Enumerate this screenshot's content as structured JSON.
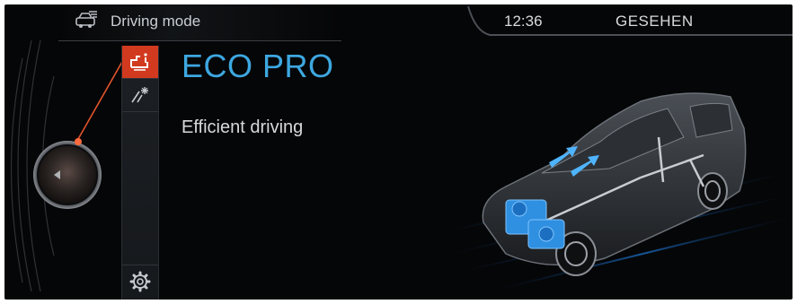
{
  "header": {
    "title": "Driving mode",
    "icon": "car-menu-icon"
  },
  "status": {
    "time": "12:36",
    "seen_label": "GESEHEN"
  },
  "menu": {
    "items": [
      {
        "name": "eco-pro-icon",
        "active": true
      },
      {
        "name": "road-light-icon",
        "active": false
      },
      {
        "name": "settings-gear-icon",
        "active": false
      }
    ]
  },
  "mode": {
    "title": "ECO PRO",
    "description": "Efficient driving"
  },
  "colors": {
    "accent_blue": "#3da7e0",
    "active_red": "#d13a1f",
    "background": "#050607"
  }
}
